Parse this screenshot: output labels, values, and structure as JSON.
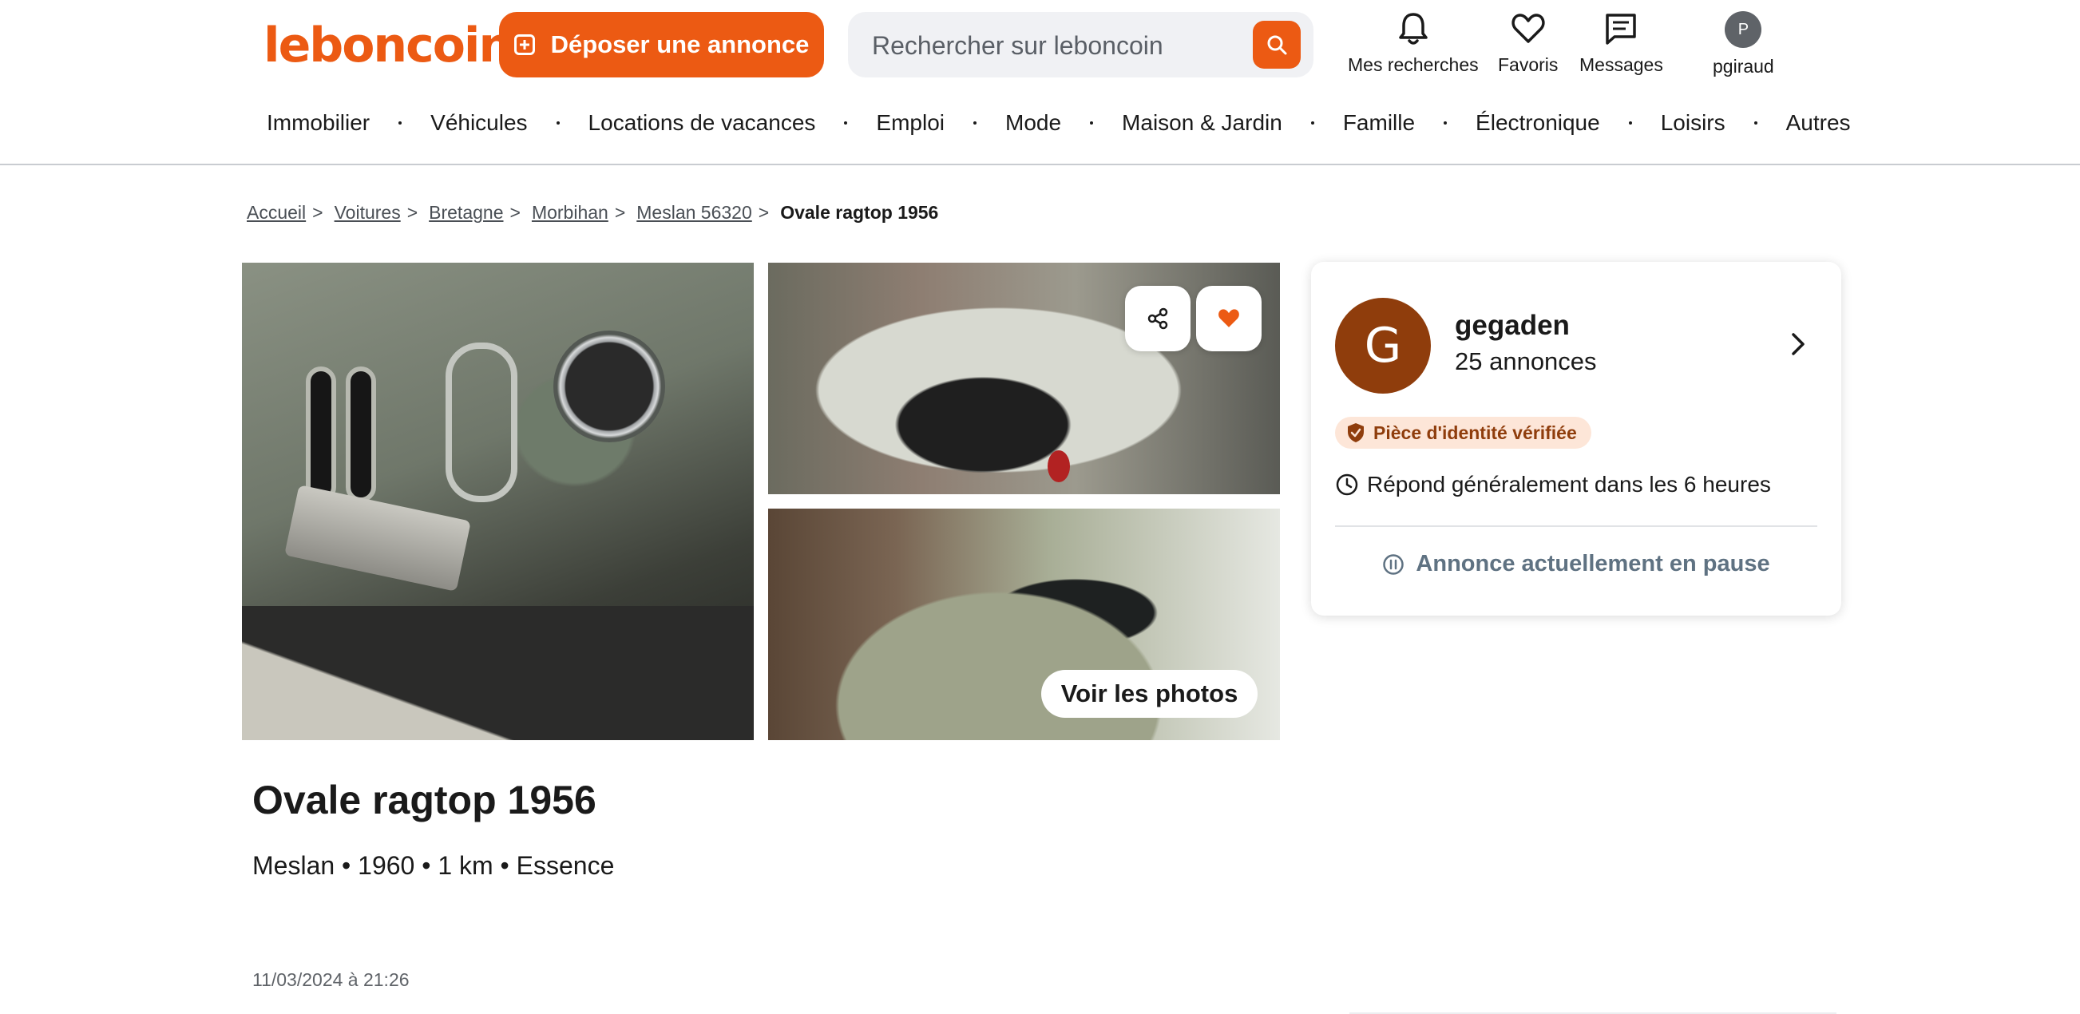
{
  "header": {
    "logo": "leboncoin",
    "deposit_label": "Déposer une annonce",
    "search_placeholder": "Rechercher sur leboncoin",
    "actions": {
      "searches": "Mes recherches",
      "favorites": "Favoris",
      "messages": "Messages",
      "user": "pgiraud",
      "user_initial": "P"
    },
    "categories": [
      "Immobilier",
      "Véhicules",
      "Locations de vacances",
      "Emploi",
      "Mode",
      "Maison & Jardin",
      "Famille",
      "Électronique",
      "Loisirs",
      "Autres"
    ]
  },
  "breadcrumb": {
    "items": [
      "Accueil",
      "Voitures",
      "Bretagne",
      "Morbihan",
      "Meslan 56320"
    ],
    "current": "Ovale ragtop 1956",
    "separator": ">"
  },
  "gallery": {
    "see_photos_label": "Voir les photos"
  },
  "ad": {
    "title": "Ovale ragtop 1956",
    "meta": "Meslan • 1960 • 1 km • Essence",
    "date": "11/03/2024 à 21:26"
  },
  "seller": {
    "initial": "G",
    "name": "gegaden",
    "ads_count": "25 annonces",
    "verified": "Pièce d'identité vérifiée",
    "response": "Répond généralement dans les 6 heures",
    "paused": "Annonce actuellement en pause"
  },
  "colors": {
    "brand": "#ec5a13",
    "seller_avatar": "#8f3d0c",
    "verified_bg": "#fde6d8",
    "paused_text": "#5f7282"
  }
}
